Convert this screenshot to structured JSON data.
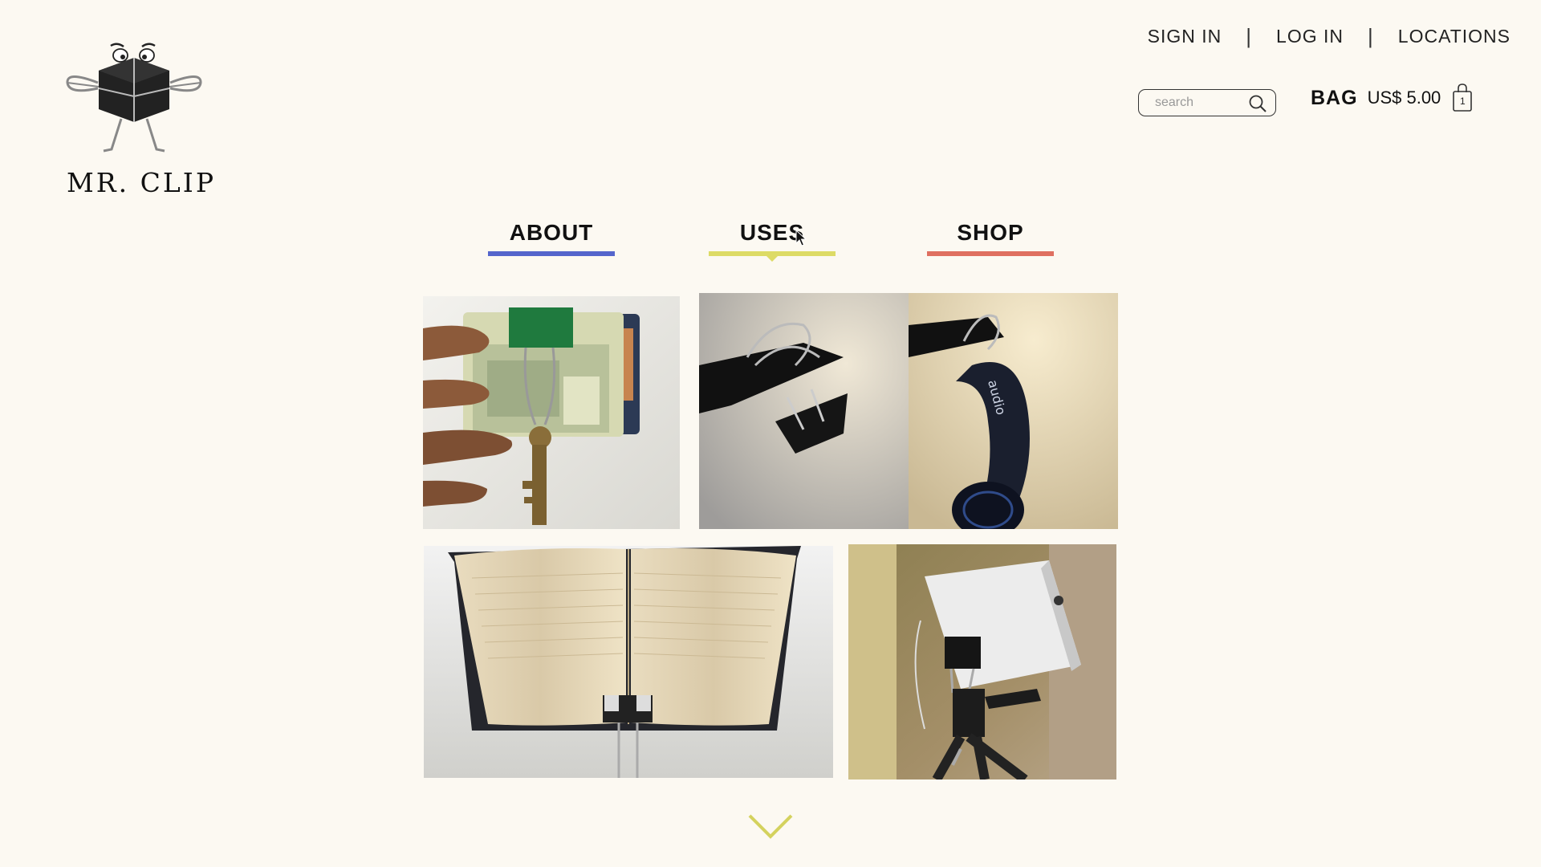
{
  "brand": {
    "name": "MR. CLIP",
    "logo_icon": "mr-clip-mascot-icon"
  },
  "toplinks": {
    "sign_in": "SIGN IN",
    "log_in": "LOG IN",
    "locations": "LOCATIONS",
    "separator": "|"
  },
  "search": {
    "placeholder": "search",
    "icon": "search-icon"
  },
  "bag": {
    "label": "BAG",
    "price": "US$ 5.00",
    "count": "1",
    "icon": "shopping-bag-icon"
  },
  "nav": {
    "items": [
      {
        "label": "ABOUT",
        "color": "#5566cc"
      },
      {
        "label": "USES",
        "color": "#dddb66",
        "active": true
      },
      {
        "label": "SHOP",
        "color": "#df7061"
      }
    ]
  },
  "gallery": {
    "photos": [
      {
        "subject": "money-and-key-clip-photo"
      },
      {
        "subject": "headphone-hanger-clip-photo"
      },
      {
        "subject": "notebook-stand-clip-photo"
      },
      {
        "subject": "phone-tripod-clip-photo"
      }
    ]
  },
  "scroll_icon": "chevron-down-icon"
}
